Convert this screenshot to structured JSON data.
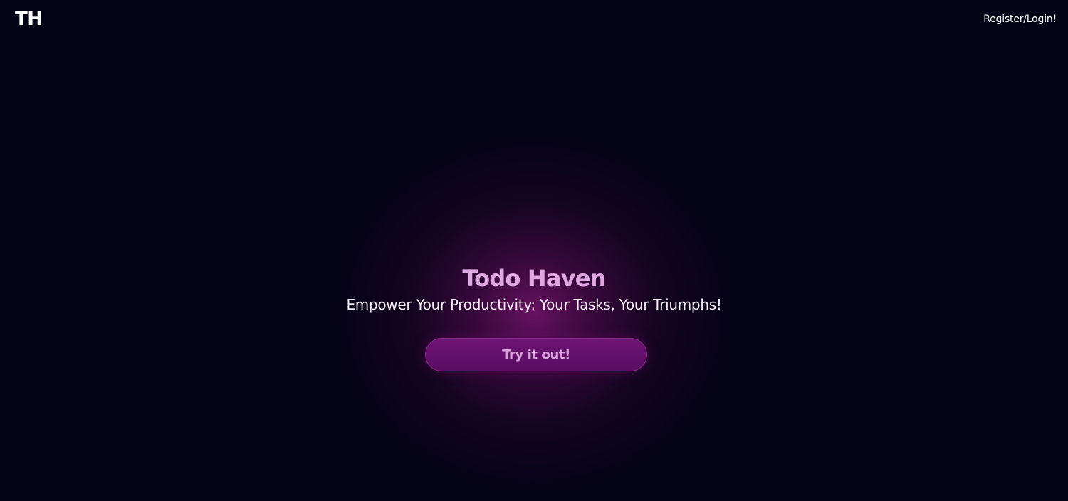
{
  "navbar": {
    "logo_text": "TH",
    "auth_link_label": "Register/Login!"
  },
  "hero": {
    "title": "Todo Haven",
    "subtitle": "Empower Your Productivity: Your Tasks, Your Triumphs!",
    "cta_label": "Try it out!"
  },
  "colors": {
    "background": "#050316",
    "accent": "#6e1476",
    "title": "#e0a8e2",
    "text": "#ffffff"
  }
}
